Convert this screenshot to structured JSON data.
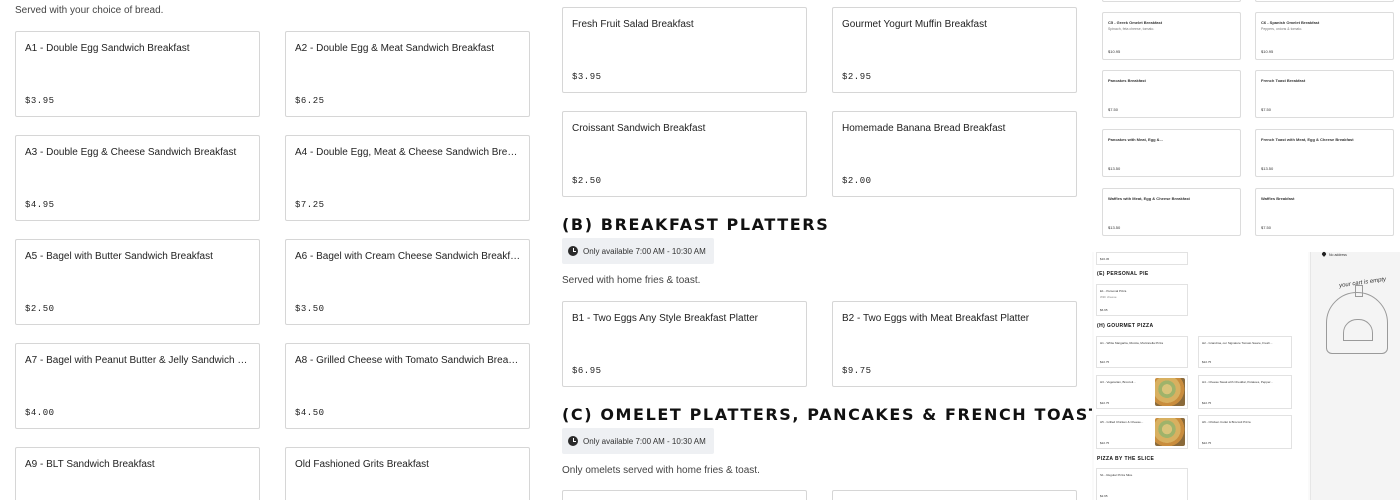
{
  "section_a": {
    "served_note": "Served with your choice of bread.",
    "items": [
      {
        "name": "A1 - Double Egg Sandwich Breakfast",
        "price": "$3.95"
      },
      {
        "name": "A2 - Double Egg & Meat Sandwich Breakfast",
        "price": "$6.25"
      },
      {
        "name": "A3 - Double Egg & Cheese Sandwich Breakfast",
        "price": "$4.95"
      },
      {
        "name": "A4 - Double Egg, Meat & Cheese Sandwich Breakfast",
        "price": "$7.25"
      },
      {
        "name": "A5 - Bagel with Butter Sandwich Breakfast",
        "price": "$2.50"
      },
      {
        "name": "A6 - Bagel with Cream Cheese Sandwich Breakfast",
        "price": "$3.50"
      },
      {
        "name": "A7 - Bagel with Peanut Butter & Jelly Sandwich Breakfast",
        "price": "$4.00"
      },
      {
        "name": "A8 - Grilled Cheese with Tomato Sandwich Breakfast",
        "price": "$4.50"
      },
      {
        "name": "A9 - BLT Sandwich Breakfast",
        "price": ""
      },
      {
        "name": "Old Fashioned Grits Breakfast",
        "price": ""
      }
    ]
  },
  "section_a_right": {
    "items": [
      {
        "name": "Fresh Fruit Salad Breakfast",
        "price": "$3.95"
      },
      {
        "name": "Gourmet Yogurt Muffin Breakfast",
        "price": "$2.95"
      },
      {
        "name": "Croissant Sandwich Breakfast",
        "price": "$2.50"
      },
      {
        "name": "Homemade Banana Bread Breakfast",
        "price": "$2.00"
      }
    ]
  },
  "section_b": {
    "title": "(B) Breakfast Platters",
    "availability": "Only available 7:00 AM - 10:30 AM",
    "note": "Served with home fries & toast.",
    "items": [
      {
        "name": "B1 - Two Eggs Any Style Breakfast Platter",
        "price": "$6.95"
      },
      {
        "name": "B2 - Two Eggs with Meat Breakfast Platter",
        "price": "$9.75"
      }
    ]
  },
  "section_c": {
    "title": "(C) Omelet Platters, Pancakes & French Toast",
    "availability": "Only available 7:00 AM - 10:30 AM",
    "note": "Only omelets served with home fries & toast."
  },
  "thumb_upper": {
    "items": [
      {
        "name": "C5 - Greek Omelet Breakfast",
        "desc": "Spinach, feta cheese, tomato.",
        "price": "$10.95"
      },
      {
        "name": "C6 - Spanish Omelet Breakfast",
        "desc": "Peppers, onions & tomato.",
        "price": "$10.95"
      },
      {
        "name": "Pancakes Breakfast",
        "desc": "",
        "price": "$7.50"
      },
      {
        "name": "French Toast Breakfast",
        "desc": "",
        "price": "$7.50"
      },
      {
        "name": "Pancakes with Meat, Egg &...",
        "desc": "",
        "price": "$13.50"
      },
      {
        "name": "French Toast with Meat, Egg & Cheese Breakfast",
        "desc": "",
        "price": "$13.50"
      },
      {
        "name": "Waffles with Meat, Egg & Cheese Breakfast",
        "desc": "",
        "price": "$13.50"
      },
      {
        "name": "Waffles Breakfast",
        "desc": "",
        "price": "$7.50"
      }
    ]
  },
  "thumb_lower": {
    "top_price": "$16.45",
    "personal_heading": "(E) PERSONAL PIE",
    "personal_item": {
      "name": "E1 - Personal Pizza",
      "desc": "With cheese",
      "price": "$6.95"
    },
    "gourmet_heading": "(H) GOURMET PIZZA",
    "gourmet_items": [
      {
        "name": "H1 - White Margarita, Ricotta, Mozzarella Pizza",
        "price": "$22.75"
      },
      {
        "name": "H2 - Grandma, our Signature Tomato Sauce, Fresh...",
        "price": "$22.75"
      },
      {
        "name": "H3 - Vegetarian, Broccoli...",
        "price": "$22.75"
      },
      {
        "name": "H4 - Cheese Steak with Cheddar, Potatoes, Pepper...",
        "price": "$22.75"
      },
      {
        "name": "H5 - Grilled Chicken & Cheese...",
        "price": "$22.75"
      },
      {
        "name": "H6 - Chicken Cutlet & Broccoli Pizza",
        "price": "$22.75"
      }
    ],
    "slice_heading": "PIZZA BY THE SLICE",
    "slice_item": {
      "name": "S1 - Regular Pizza Slice",
      "price": "$2.95"
    },
    "cart_address": "No address",
    "cart_empty": "your cart is empty"
  },
  "colors": {
    "availability_bg": "#eef0f3",
    "card_border": "#d6d6d6"
  }
}
